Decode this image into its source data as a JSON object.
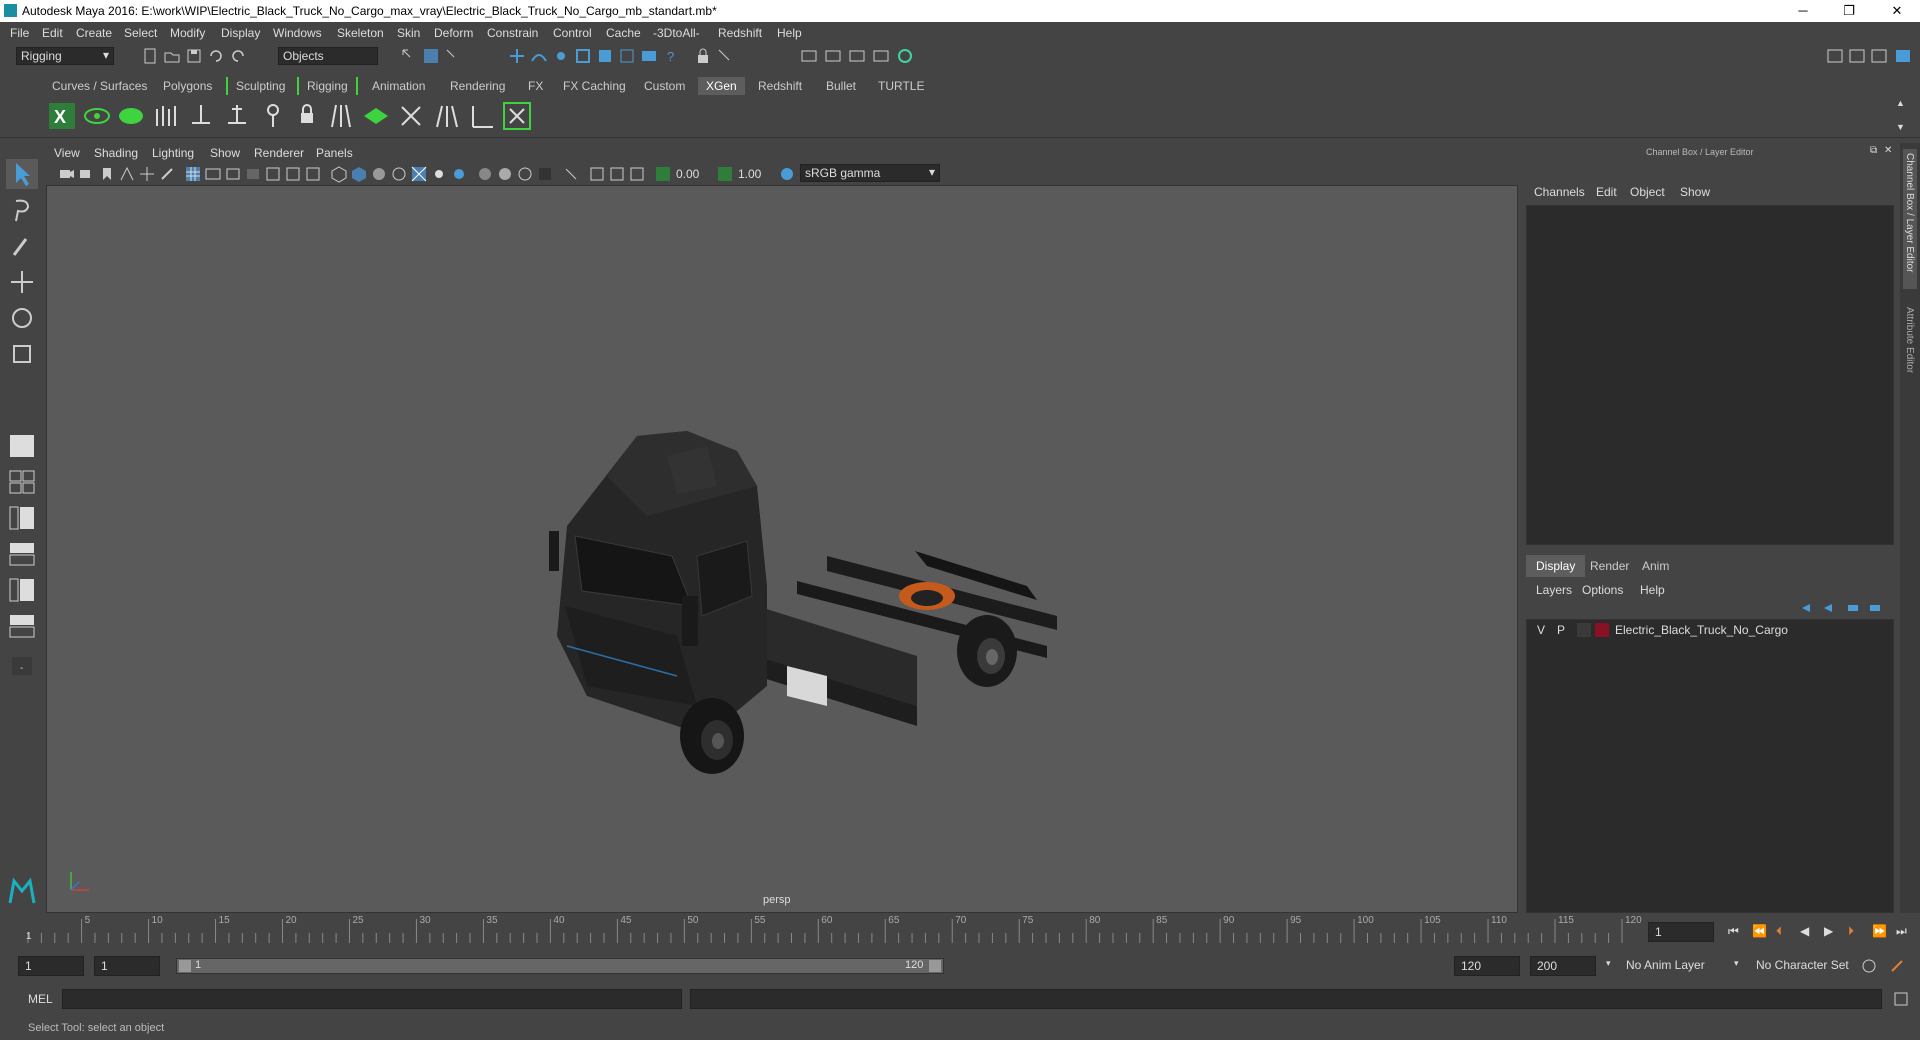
{
  "window": {
    "title": "Autodesk Maya 2016: E:\\work\\WIP\\Electric_Black_Truck_No_Cargo_max_vray\\Electric_Black_Truck_No_Cargo_mb_standart.mb*",
    "minimize": "─",
    "maximize": "❐",
    "close": "✕"
  },
  "menubar": [
    "File",
    "Edit",
    "Create",
    "Select",
    "Modify",
    "Display",
    "Windows",
    "Skeleton",
    "Skin",
    "Deform",
    "Constrain",
    "Control",
    "Cache",
    "-3DtoAll-",
    "Redshift",
    "Help"
  ],
  "statusline": {
    "mode": "Rigging",
    "selection_mode": "Objects"
  },
  "shelf_tabs": [
    "Curves / Surfaces",
    "Polygons",
    "Sculpting",
    "Rigging",
    "Animation",
    "Rendering",
    "FX",
    "FX Caching",
    "Custom",
    "XGen",
    "Redshift",
    "Bullet",
    "TURTLE"
  ],
  "shelf_active": "XGen",
  "viewport": {
    "menu": [
      "View",
      "Shading",
      "Lighting",
      "Show",
      "Renderer",
      "Panels"
    ],
    "exposure": "0.00",
    "gamma": "1.00",
    "color_space": "sRGB gamma",
    "camera_label": "persp"
  },
  "channel_box": {
    "title": "Channel Box / Layer Editor",
    "menu": [
      "Channels",
      "Edit",
      "Object",
      "Show"
    ]
  },
  "layer_editor": {
    "tabs": [
      "Display",
      "Render",
      "Anim"
    ],
    "active_tab": "Display",
    "menu": [
      "Layers",
      "Options",
      "Help"
    ],
    "layers": [
      {
        "visible": "V",
        "playback": "P",
        "name": "Electric_Black_Truck_No_Cargo",
        "color": "#8a1024"
      }
    ]
  },
  "side_tabs": [
    "Channel Box / Layer Editor",
    "Attribute Editor"
  ],
  "timeline": {
    "ticks": [
      "5",
      "10",
      "15",
      "20",
      "25",
      "30",
      "35",
      "40",
      "45",
      "50",
      "55",
      "60",
      "65",
      "70",
      "75",
      "80",
      "85",
      "90",
      "95",
      "100",
      "105",
      "110",
      "115",
      "120"
    ],
    "start_label": "1",
    "current_frame": "1"
  },
  "range": {
    "start": "1",
    "playback_start": "1",
    "slider_start": "1",
    "slider_end": "120",
    "playback_end": "120",
    "end": "200",
    "anim_layer": "No Anim Layer",
    "character_set": "No Character Set"
  },
  "cmdline": {
    "label": "MEL"
  },
  "helpline": {
    "text": "Select Tool: select an object"
  },
  "colors": {
    "accent": "#4a9cd6",
    "shelf_green": "#3fd43f",
    "layer_red": "#8a1024"
  }
}
